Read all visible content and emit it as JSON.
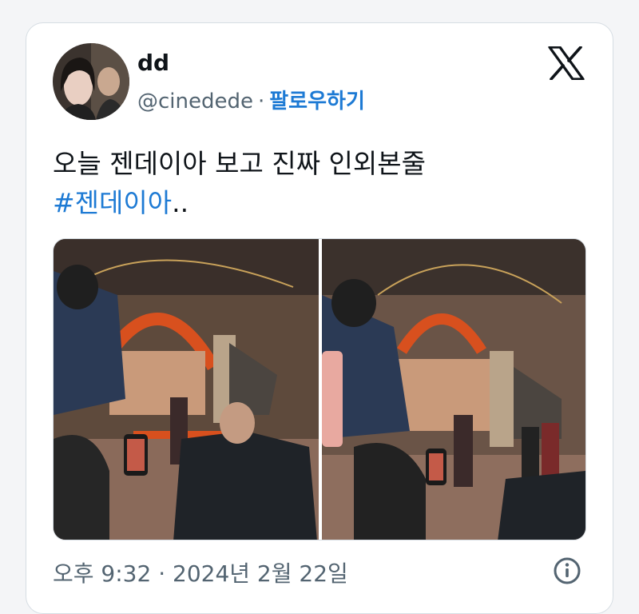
{
  "tweet": {
    "author_name": "dd",
    "author_handle": "@cinedede",
    "separator": "·",
    "follow_label": "팔로우하기",
    "text_line1": "오늘 젠데이아 보고 진짜 인외본줄",
    "hashtag": "#젠데이아",
    "text_suffix": "..",
    "timestamp": "오후 9:32 · 2024년 2월 22일"
  },
  "icons": {
    "brand": "x-logo-icon",
    "info": "info-icon",
    "avatar": "avatar-image"
  },
  "colors": {
    "link": "#1d7ad4",
    "text": "#0f1419",
    "muted": "#536471",
    "border": "#d6dde3"
  },
  "media": {
    "count": 2,
    "photos": [
      "photo-1",
      "photo-2"
    ]
  }
}
